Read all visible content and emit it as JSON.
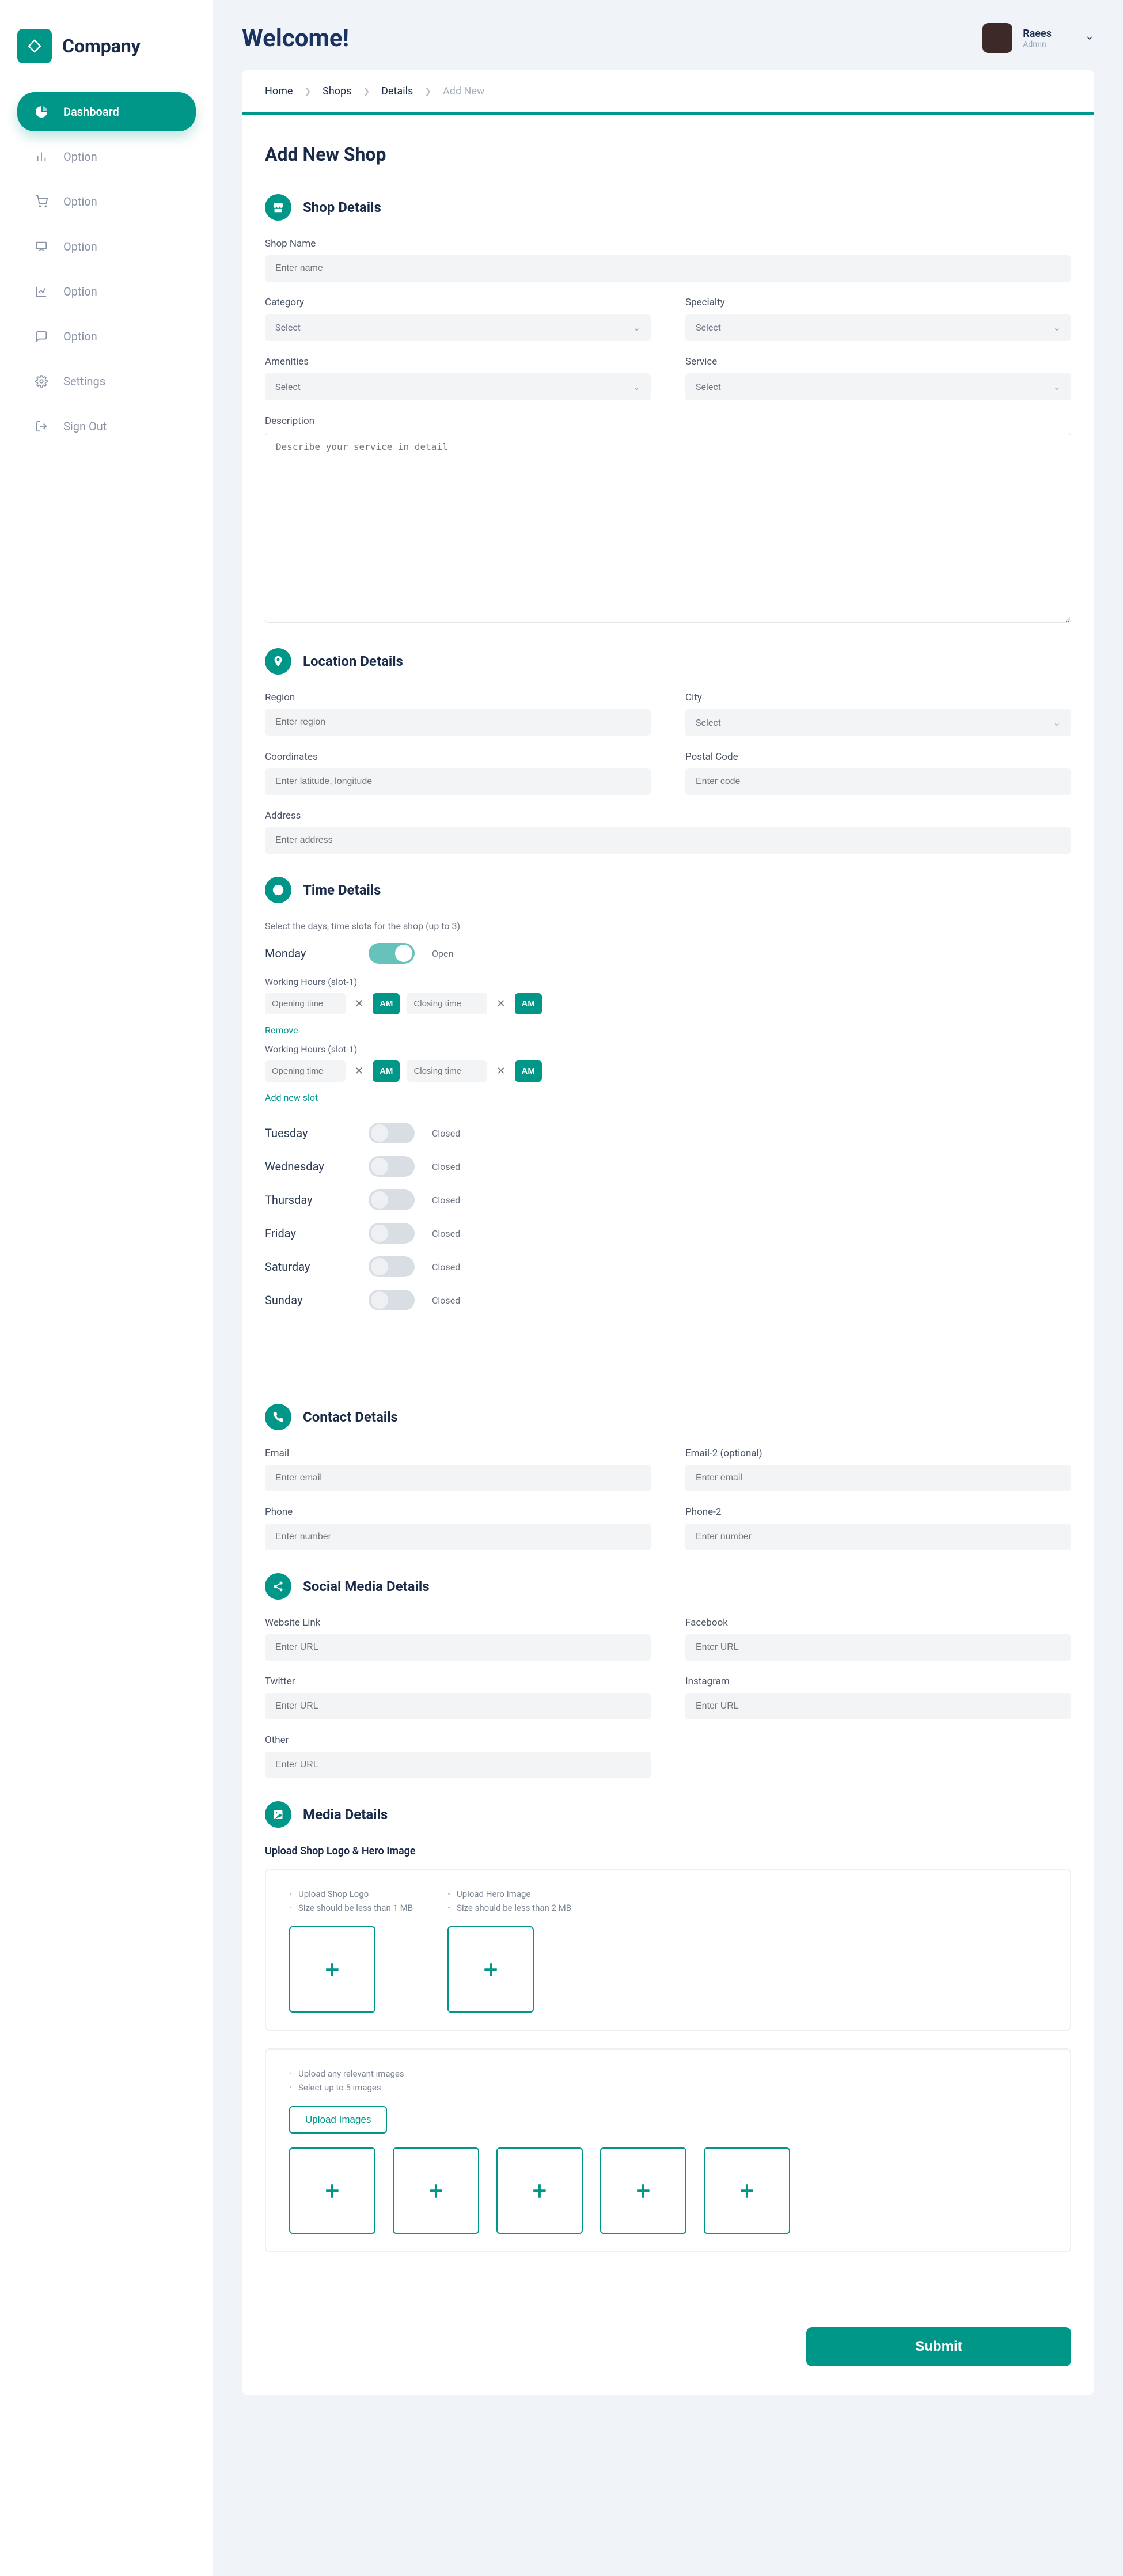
{
  "brand": {
    "name": "Company"
  },
  "nav": {
    "items": [
      {
        "label": "Dashboard",
        "active": true
      },
      {
        "label": "Option"
      },
      {
        "label": "Option"
      },
      {
        "label": "Option"
      },
      {
        "label": "Option"
      },
      {
        "label": "Option"
      },
      {
        "label": "Settings"
      },
      {
        "label": "Sign Out"
      }
    ]
  },
  "header": {
    "welcome": "Welcome!",
    "user": {
      "name": "Raees",
      "role": "Admin"
    }
  },
  "breadcrumb": {
    "items": [
      "Home",
      "Shops",
      "Details"
    ],
    "current": "Add New"
  },
  "page": {
    "title": "Add New Shop"
  },
  "sections": {
    "shop": {
      "title": "Shop Details",
      "fields": {
        "shopName": {
          "label": "Shop Name",
          "placeholder": "Enter name"
        },
        "category": {
          "label": "Category",
          "placeholder": "Select"
        },
        "specialty": {
          "label": "Specialty",
          "placeholder": "Select"
        },
        "amenities": {
          "label": "Amenities",
          "placeholder": "Select"
        },
        "service": {
          "label": "Service",
          "placeholder": "Select"
        },
        "description": {
          "label": "Description",
          "placeholder": "Describe your service in detail"
        }
      }
    },
    "location": {
      "title": "Location Details",
      "fields": {
        "region": {
          "label": "Region",
          "placeholder": "Enter region"
        },
        "city": {
          "label": "City",
          "placeholder": "Select"
        },
        "coordinates": {
          "label": "Coordinates",
          "placeholder": "Enter latitude, longitude"
        },
        "postal": {
          "label": "Postal Code",
          "placeholder": "Enter code"
        },
        "address": {
          "label": "Address",
          "placeholder": "Enter address"
        }
      }
    },
    "time": {
      "title": "Time Details",
      "hint": "Select the days, time slots for the shop (up to 3)",
      "open": "Open",
      "closed": "Closed",
      "slotLabelPrefix": "Working Hours (slot-",
      "slotLabelSuffix": ")",
      "openingPlaceholder": "Opening time",
      "closingPlaceholder": "Closing time",
      "ampm": "AM",
      "remove": "Remove",
      "addSlot": "Add new slot",
      "days": {
        "mon": "Monday",
        "tue": "Tuesday",
        "wed": "Wednesday",
        "thu": "Thursday",
        "fri": "Friday",
        "sat": "Saturday",
        "sun": "Sunday"
      }
    },
    "contact": {
      "title": "Contact Details",
      "fields": {
        "email": {
          "label": "Email",
          "placeholder": "Enter email"
        },
        "email2": {
          "label": "Email-2 (optional)",
          "placeholder": "Enter email"
        },
        "phone": {
          "label": "Phone",
          "placeholder": "Enter number"
        },
        "phone2": {
          "label": "Phone-2",
          "placeholder": "Enter number"
        }
      }
    },
    "social": {
      "title": "Social Media Details",
      "fields": {
        "website": {
          "label": "Website Link",
          "placeholder": "Enter URL"
        },
        "facebook": {
          "label": "Facebook",
          "placeholder": "Enter URL"
        },
        "twitter": {
          "label": "Twitter",
          "placeholder": "Enter URL"
        },
        "instagram": {
          "label": "Instagram",
          "placeholder": "Enter URL"
        },
        "other": {
          "label": "Other",
          "placeholder": "Enter URL"
        }
      }
    },
    "media": {
      "title": "Media Details",
      "heading": "Upload Shop Logo & Hero Image",
      "logoBullets": [
        "Upload Shop Logo",
        "Size should be less than 1 MB"
      ],
      "heroBullets": [
        "Upload Hero Image",
        "Size should be less than 2 MB"
      ],
      "galleryBullets": [
        "Upload any relevant images",
        "Select up to 5 images"
      ],
      "uploadBtn": "Upload Images"
    }
  },
  "submit": "Submit"
}
